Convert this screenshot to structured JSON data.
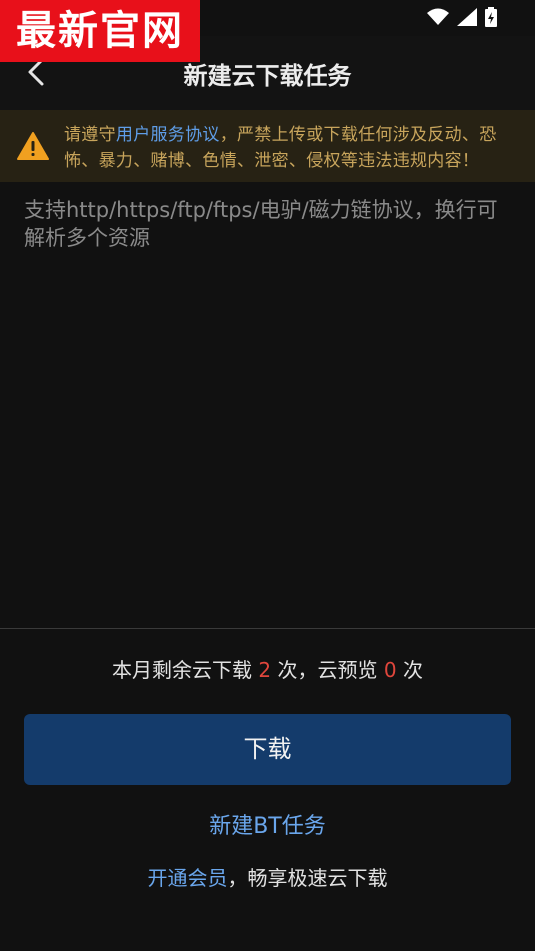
{
  "watermark": "最新官网",
  "header": {
    "title": "新建云下载任务",
    "back_icon": "chevron-left-icon"
  },
  "notice": {
    "prefix": "请遵守",
    "link": "用户服务协议",
    "suffix": "，严禁上传或下载任何涉及反动、恐怖、暴力、赌博、色情、泄密、侵权等违法违规内容！",
    "icon": "warning-icon",
    "accent": "#c8a55c",
    "link_color": "#5f9ee8"
  },
  "input": {
    "placeholder": "支持http/https/ftp/ftps/电驴/磁力链协议，换行可解析多个资源",
    "value": ""
  },
  "quota": {
    "prefix": "本月剩余云下载",
    "downloads": "2",
    "mid": "次，云预览",
    "previews": "0",
    "suffix": "次",
    "number_color": "#e0463c"
  },
  "actions": {
    "download_label": "下载",
    "bt_label": "新建BT任务",
    "vip_link": "开通会员",
    "vip_text": "，畅享极速云下载",
    "button_color": "#143b6b"
  }
}
